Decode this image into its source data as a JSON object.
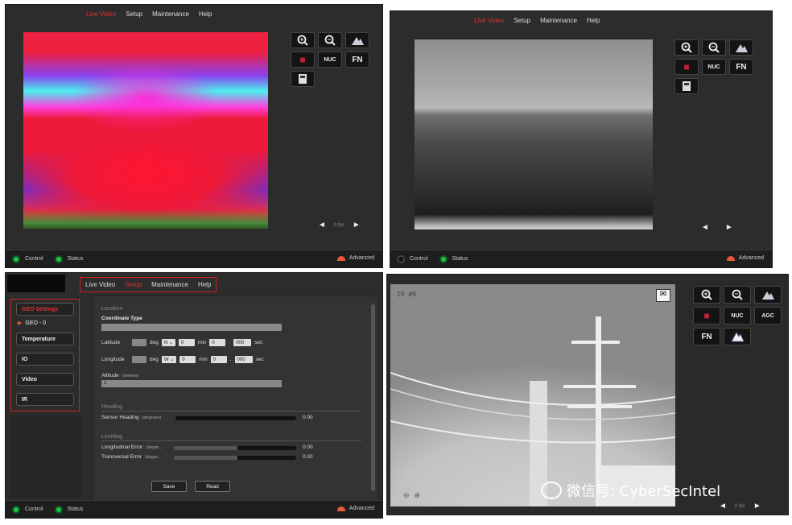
{
  "nav": {
    "live_video": "Live Video",
    "setup": "Setup",
    "maintenance": "Maintenance",
    "help": "Help"
  },
  "icons": {
    "zoom_in": "zoom-in-icon",
    "zoom_out": "zoom-out-icon",
    "mountain": "mountain-icon",
    "palette": "palette-icon",
    "nuc": "NUC",
    "fn": "FN",
    "agc": "AGC",
    "save": "save-icon"
  },
  "fps": {
    "left": "◄",
    "label": "0 fps",
    "right": "►"
  },
  "bottom": {
    "control": "Control",
    "status": "Status",
    "advanced": "Advanced"
  },
  "setup_panel": {
    "sidebar": [
      {
        "label": "GEO Settings",
        "active": true
      },
      {
        "label": "GEO - 0",
        "sub": true
      },
      {
        "label": "Temperature"
      },
      {
        "label": "IO"
      },
      {
        "label": "Video"
      },
      {
        "label": "IR"
      }
    ],
    "location": {
      "section": "Location",
      "coord_type": "Coordinate Type",
      "latitude": "Latitude",
      "longitude": "Longitude",
      "deg": "deg",
      "min": "min",
      "sec": "sec",
      "lat_dir": "N",
      "lon_dir": "W",
      "lat_min": "0",
      "lat_sec": "000",
      "lon_min": "0",
      "lon_sec": "000",
      "dot": ".",
      "altitude": "Altitude",
      "altitude_unit": "(meters)",
      "altitude_value": "1"
    },
    "heading": {
      "section": "Heading",
      "sensor_heading": "Sensor Heading",
      "unit": "(degrees)",
      "value": "0.00"
    },
    "leveling": {
      "section": "Leveling",
      "long_error": "Longitudinal Error",
      "long_unit": "(degre...",
      "long_value": "0.00",
      "trans_error": "Transversal Error",
      "trans_unit": "(degre...",
      "trans_value": "0.00"
    },
    "save": "Save",
    "read": "Read"
  },
  "ir_label": "IR #0",
  "watermark": "微信号: CyberSecIntel"
}
